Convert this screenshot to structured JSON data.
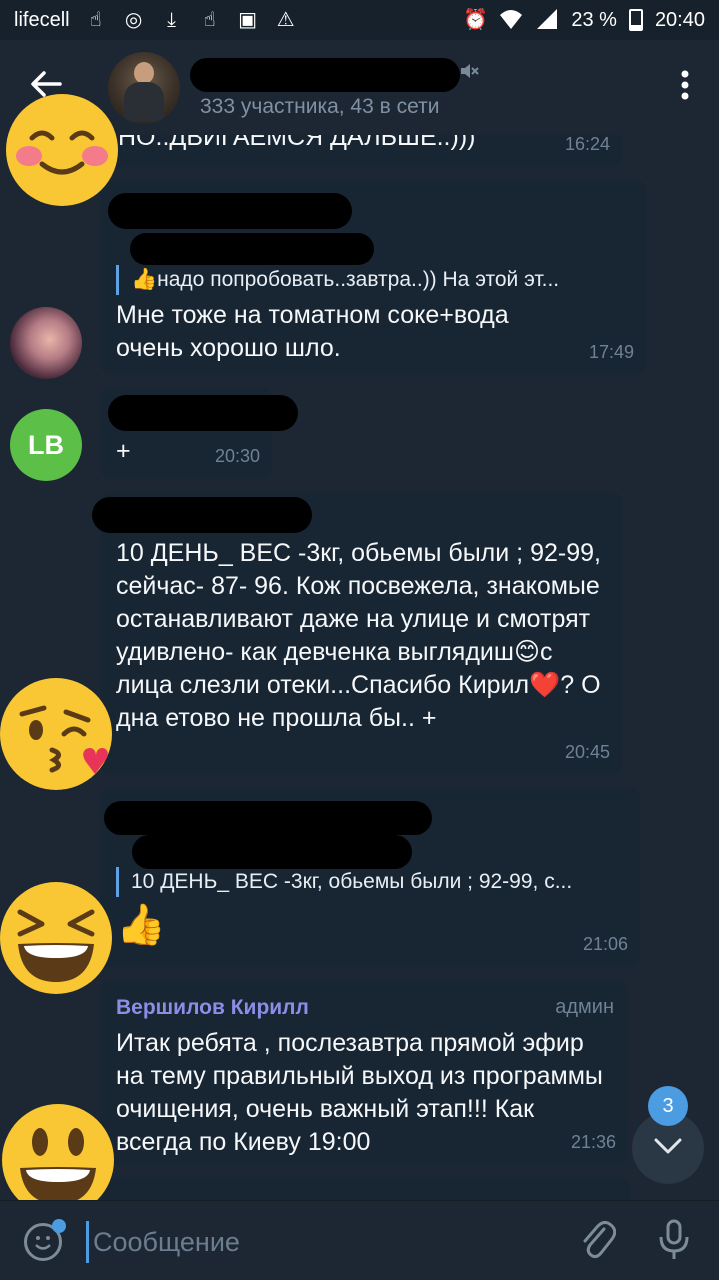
{
  "status_bar": {
    "carrier": "lifecell",
    "battery": "23 %",
    "time": "20:40"
  },
  "header": {
    "back_icon": "arrow-left-icon",
    "subtitle": "333 участника, 43 в сети",
    "muted": true
  },
  "messages": [
    {
      "text": "НО..ДВИГАЕМСЯ ДАЛЬШЕ..)))",
      "time": "16:24"
    },
    {
      "reply_text": "👍надо попробовать..завтра..)) На этой эт...",
      "text": "Мне тоже на томатном соке+вода очень хорошо шло.",
      "time": "17:49"
    },
    {
      "avatar_initials": "LB",
      "text": "+",
      "time": "20:30"
    },
    {
      "text": "10 ДЕНЬ_ ВЕС -3кг, обьемы были ; 92-99, сейчас- 87- 96. Кож посвежела, знакомые останавливают даже на улице и смотрят удивлено- как девченка выглядиш😊с лица слезли отеки...Спасибо Кирил❤️? О дна етово не прошла бы.. +",
      "time": "20:45"
    },
    {
      "reply_text": "10 ДЕНЬ_ ВЕС -3кг, обьемы были ; 92-99, с...",
      "text": "👍",
      "time": "21:06"
    },
    {
      "sender": "Вершилов Кирилл",
      "role": "админ",
      "text": "Итак ребята , послезавтра прямой эфир на тему правильный выход из программы очищения, очень важный этап!!! Как всегда по Киеву 19:00",
      "time": "21:36"
    }
  ],
  "scroll_down": {
    "unread_count": "3"
  },
  "input": {
    "placeholder": "Сообщение"
  },
  "colors": {
    "background": "#1d2733",
    "bubble": "#182533",
    "accent": "#4c9ce2",
    "admin_name": "#8e8de6"
  }
}
